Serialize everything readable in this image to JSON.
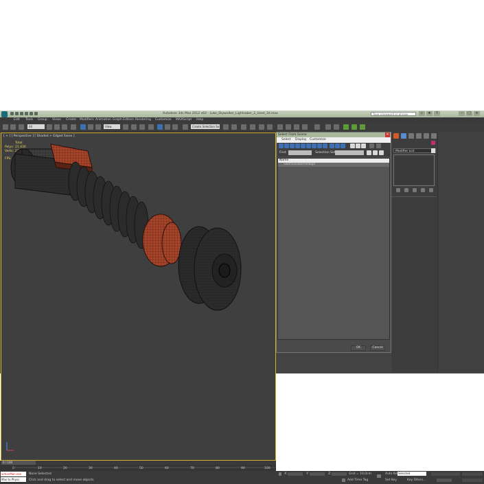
{
  "window": {
    "title": "Autodesk 3ds Max 2012 x64  -  Luke_Skywalker_Lightsaber_2_Used_3d.max",
    "search_placeholder": "Type a keyword or phrase"
  },
  "menubar": [
    "Edit",
    "Tools",
    "Group",
    "Views",
    "Create",
    "Modifiers",
    "Animation",
    "Graph Editors",
    "Rendering",
    "Customize",
    "MAXScript",
    "Help"
  ],
  "toolbar": {
    "filter_value": "All",
    "refcoord_value": "View",
    "named_sel_placeholder": "Create Selection Se"
  },
  "viewport": {
    "label": "[ + ] [ Perspective ] [ Shaded + Edged Faces ]",
    "stats": {
      "total_label": "Total",
      "polys_label": "Polys:",
      "polys_value": "21 430",
      "verts_label": "Verts:",
      "verts_value": "22 738",
      "fps_label": "FPS:",
      "fps_value": "74.597"
    }
  },
  "dialog": {
    "title": "Select From Scene",
    "menu": [
      "Select",
      "Display",
      "Customize"
    ],
    "find_label": "Find:",
    "selection_set_label": "Selection Set:",
    "column_name": "Name",
    "rows": [
      "Sword3saberHinkopl"
    ],
    "ok_label": "OK",
    "cancel_label": "Cancel"
  },
  "command_panel": {
    "modifier_list_label": "Modifier List"
  },
  "timeline": {
    "frame_label": "0 / 100",
    "ticks": [
      "0",
      "10",
      "20",
      "30",
      "40",
      "50",
      "60",
      "70",
      "80",
      "90",
      "100"
    ]
  },
  "status": {
    "maxscript_line1": "actionMan.exe",
    "maxscript_line2": "Max to Physc",
    "selection": "None Selected",
    "prompt": "Click and drag to select and move objects",
    "x_label": "X:",
    "y_label": "Y:",
    "z_label": "Z:",
    "grid": "Grid = 10,0cm",
    "add_time_tag": "Add Time Tag",
    "auto_key": "Auto Key",
    "selected_dropdown": "Selected",
    "set_key": "Set Key",
    "key_filters": "Key Filters..."
  },
  "colors": {
    "viewport_bg": "#3f3f3f",
    "active_border": "#d8b12a",
    "stats_text": "#e8d85a",
    "wire": "#1a1a1a",
    "accent_orange": "#b5452a"
  }
}
